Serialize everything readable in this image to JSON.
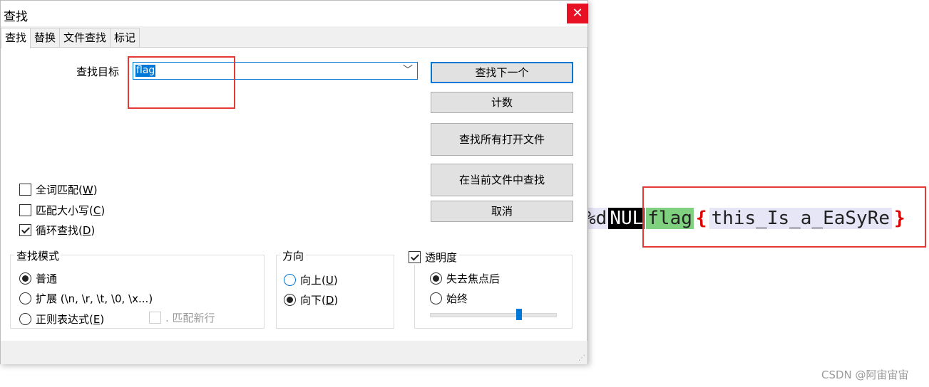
{
  "dialog": {
    "title": "查找",
    "tabs": [
      "查找",
      "替换",
      "文件查找",
      "标记"
    ],
    "target_label": "查找目标",
    "search_value": "flag",
    "buttons": {
      "find_next": "查找下一个",
      "count": "计数",
      "find_all_open": "查找所有打开文件",
      "find_in_current": "在当前文件中查找",
      "cancel": "取消"
    },
    "options": [
      {
        "text": "全词匹配(",
        "key": "W",
        "checked": false
      },
      {
        "text": "匹配大小写(",
        "key": "C",
        "checked": false
      },
      {
        "text": "循环查找(",
        "key": "D",
        "checked": true
      }
    ],
    "search_mode": {
      "title": "查找模式",
      "normal": "普通",
      "extended": "扩展 (\\n, \\r, \\t, \\0, \\x...)",
      "regex_text": "正则表达式(",
      "regex_key": "E",
      "dot_newline": ". 匹配新行"
    },
    "direction": {
      "title": "方向",
      "up_text": "向上(",
      "up_key": "U",
      "down_text": "向下(",
      "down_key": "D"
    },
    "transparency": {
      "title": "透明度",
      "on_lose_focus": "失去焦点后",
      "always": "始终",
      "level": 0.7
    }
  },
  "editor": {
    "pre": "%d",
    "nul": "NUL",
    "flag": "flag",
    "open_brace": "{",
    "body": "this_Is_a_EaSyRe",
    "close_brace": "}"
  },
  "watermark": "CSDN @阿宙宙宙"
}
